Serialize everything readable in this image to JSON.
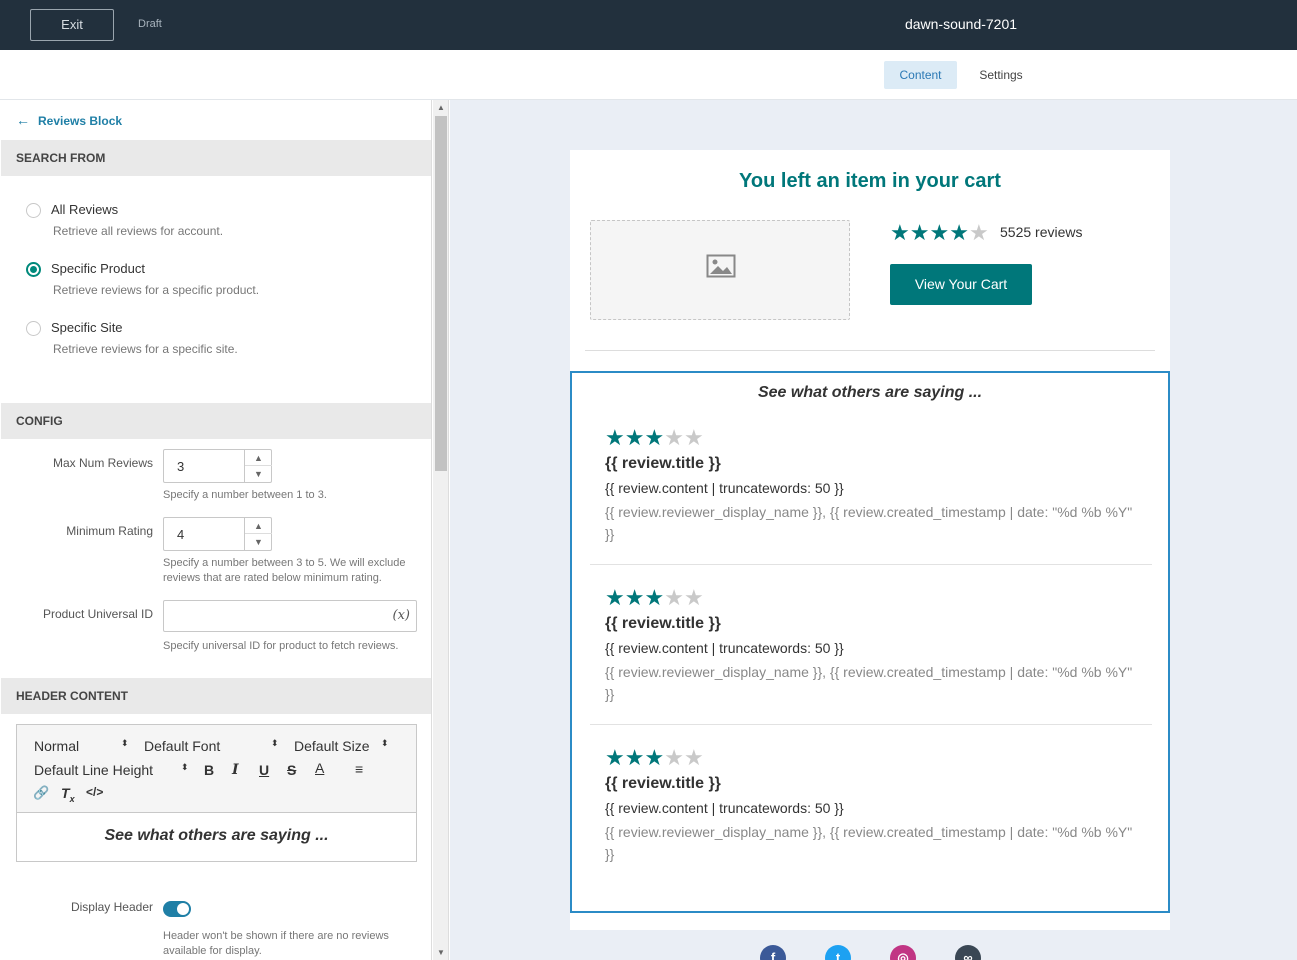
{
  "topbar": {
    "exit_label": "Exit",
    "status": "Draft",
    "doc_title": "dawn-sound-7201"
  },
  "tabs": [
    {
      "label": "Content",
      "active": true
    },
    {
      "label": "Settings",
      "active": false
    }
  ],
  "sidebar": {
    "back_label": "Reviews Block",
    "search_from": {
      "heading": "SEARCH FROM",
      "options": [
        {
          "label": "All Reviews",
          "desc": "Retrieve all reviews for account.",
          "selected": false
        },
        {
          "label": "Specific Product",
          "desc": "Retrieve reviews for a specific product.",
          "selected": true
        },
        {
          "label": "Specific Site",
          "desc": "Retrieve reviews for a specific site.",
          "selected": false
        }
      ]
    },
    "config": {
      "heading": "CONFIG",
      "max_num_label": "Max Num Reviews",
      "max_num_value": "3",
      "max_num_help": "Specify a number between 1 to 3.",
      "min_rating_label": "Minimum Rating",
      "min_rating_value": "4",
      "min_rating_help": "Specify a number between 3 to 5. We will exclude reviews that are rated below minimum rating.",
      "product_id_label": "Product Universal ID",
      "product_id_value": "",
      "product_id_fx": "(x)",
      "product_id_help": "Specify universal ID for product to fetch reviews."
    },
    "header_content": {
      "heading": "HEADER CONTENT",
      "toolbar": {
        "format": "Normal",
        "font": "Default Font",
        "size": "Default Size",
        "line_height": "Default Line Height"
      },
      "body": "See what others are saying ...",
      "display_header_label": "Display Header",
      "display_header_on": true,
      "display_header_help": "Header won't be shown if there are no reviews available for display."
    }
  },
  "email": {
    "title": "You left an item in your cart",
    "product_rating": 4,
    "review_count": "5525 reviews",
    "cart_button": "View Your Cart",
    "reviews_heading": "See what others are saying ...",
    "reviews": [
      {
        "rating": 3,
        "title": "{{ review.title }}",
        "content": "{{ review.content | truncatewords: 50 }}",
        "meta": "{{ review.reviewer_display_name }}, {{ review.created_timestamp | date: \"%d %b %Y\" }}"
      },
      {
        "rating": 3,
        "title": "{{ review.title }}",
        "content": "{{ review.content | truncatewords: 50 }}",
        "meta": "{{ review.reviewer_display_name }}, {{ review.created_timestamp | date: \"%d %b %Y\" }}"
      },
      {
        "rating": 3,
        "title": "{{ review.title }}",
        "content": "{{ review.content | truncatewords: 50 }}",
        "meta": "{{ review.reviewer_display_name }}, {{ review.created_timestamp | date: \"%d %b %Y\" }}"
      }
    ],
    "social": [
      {
        "name": "facebook-icon",
        "glyph": "f",
        "color": "#3b5998"
      },
      {
        "name": "twitter-icon",
        "glyph": "t",
        "color": "#1da1f2"
      },
      {
        "name": "instagram-icon",
        "glyph": "◎",
        "color": "#c13584"
      },
      {
        "name": "link-icon",
        "glyph": "∞",
        "color": "#3a4754"
      }
    ]
  }
}
